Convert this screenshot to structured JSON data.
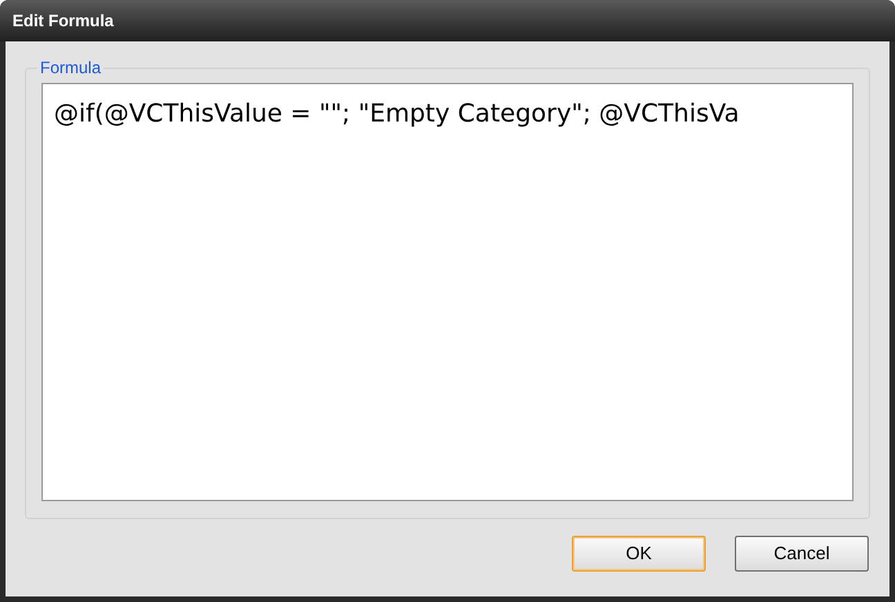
{
  "window": {
    "title": "Edit Formula"
  },
  "formula_group": {
    "legend": "Formula",
    "field": {
      "value": "@if(@VCThisValue = \"\"; \"Empty Category\"; @VCThisVa"
    }
  },
  "buttons": [
    {
      "label": "OK",
      "default": true
    },
    {
      "label": "Cancel",
      "default": false
    }
  ]
}
